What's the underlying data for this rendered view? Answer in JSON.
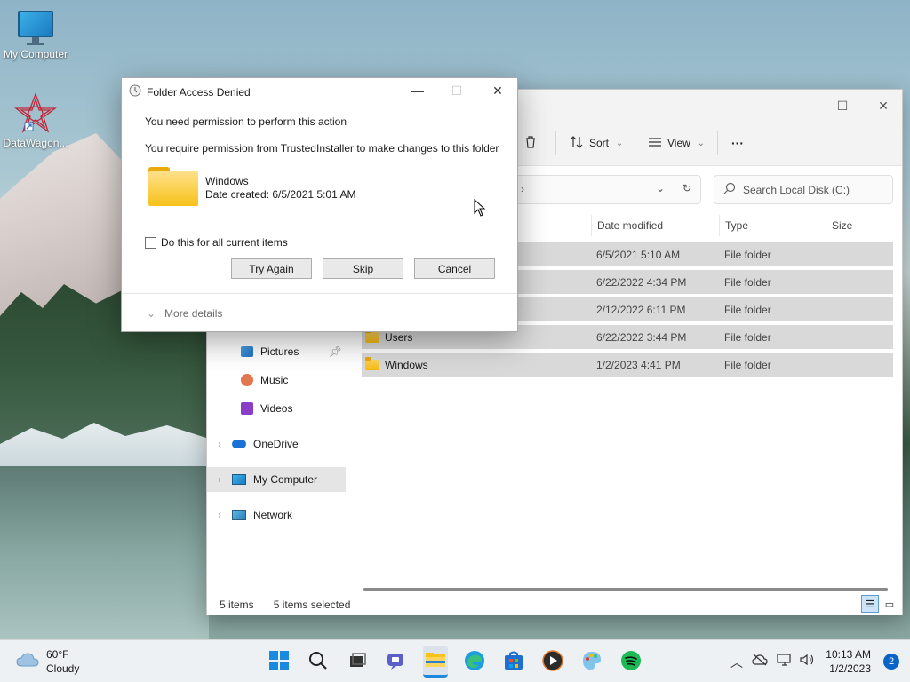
{
  "desktop": {
    "icons": [
      {
        "label": "My Computer"
      },
      {
        "label": "DataWagon..."
      }
    ]
  },
  "explorer": {
    "toolbar": {
      "sort_label": "Sort",
      "view_label": "View",
      "more_label": "···"
    },
    "search_placeholder": "Search Local Disk (C:)",
    "columns": [
      "Date modified",
      "Type",
      "Size"
    ],
    "rows": [
      {
        "name": "",
        "date": "6/5/2021 5:10 AM",
        "type": "File folder"
      },
      {
        "name": "",
        "date": "6/22/2022 4:34 PM",
        "type": "File folder"
      },
      {
        "name": "",
        "date": "2/12/2022 6:11 PM",
        "type": "File folder"
      },
      {
        "name": "Users",
        "date": "6/22/2022 3:44 PM",
        "type": "File folder"
      },
      {
        "name": "Windows",
        "date": "1/2/2023 4:41 PM",
        "type": "File folder"
      }
    ],
    "nav": {
      "pictures": "Pictures",
      "music": "Music",
      "videos": "Videos",
      "onedrive": "OneDrive",
      "my_computer": "My Computer",
      "network": "Network"
    },
    "status": {
      "items": "5 items",
      "selected": "5 items selected"
    }
  },
  "dialog": {
    "title": "Folder Access Denied",
    "line1": "You need permission to perform this action",
    "line2": "You require permission from TrustedInstaller to make changes to this folder",
    "folder_name": "Windows",
    "folder_date": "Date created: 6/5/2021 5:01 AM",
    "checkbox_label": "Do this for all current items",
    "buttons": {
      "try_again": "Try Again",
      "skip": "Skip",
      "cancel": "Cancel"
    },
    "more_details": "More details"
  },
  "taskbar": {
    "weather_temp": "60°F",
    "weather_desc": "Cloudy",
    "time": "10:13 AM",
    "date": "1/2/2023",
    "notification_count": "2"
  }
}
